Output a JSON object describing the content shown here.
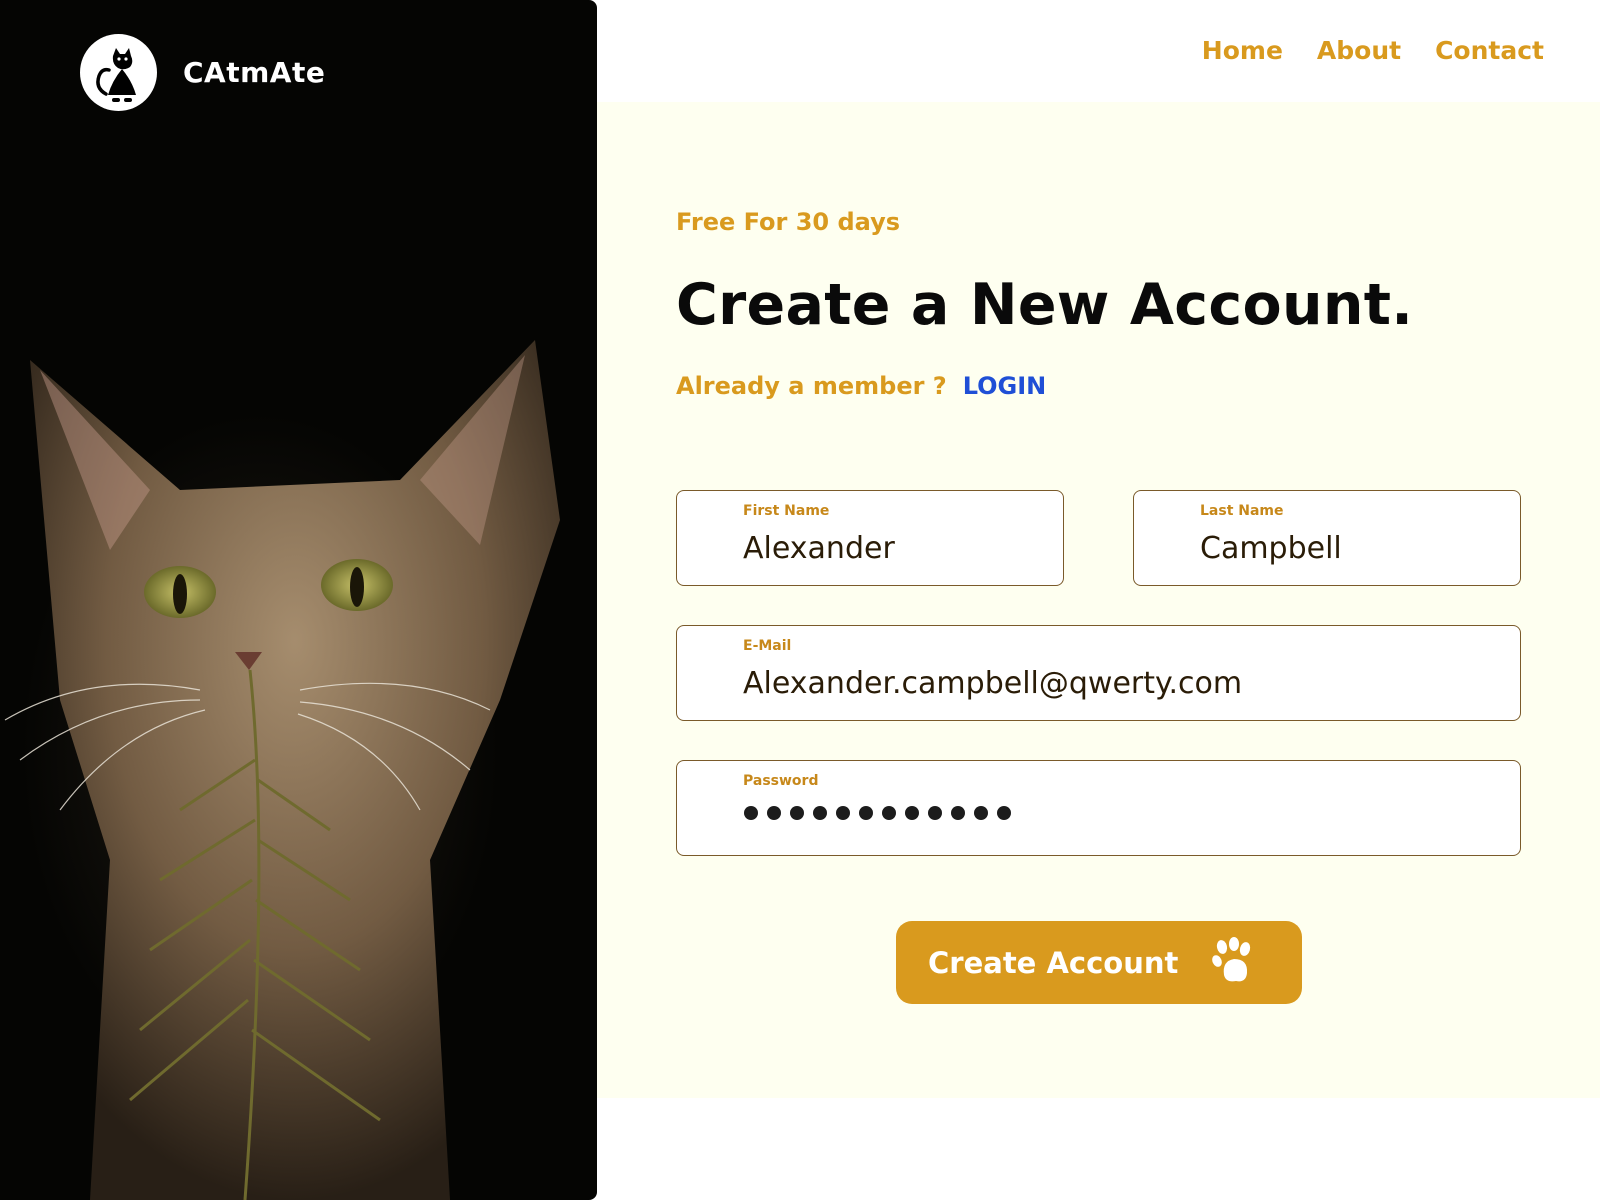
{
  "brand": {
    "name": "CAtmAte",
    "logo_icon": "cat-logo-icon"
  },
  "nav": {
    "items": [
      "Home",
      "About",
      "Contact"
    ]
  },
  "promo": "Free For 30 days",
  "heading": "Create a New Account.",
  "member": {
    "text": "Already a member ?",
    "login_label": "LOGIN"
  },
  "form": {
    "first_name": {
      "label": "First Name",
      "value": "Alexander"
    },
    "last_name": {
      "label": "Last Name",
      "value": "Campbell"
    },
    "email": {
      "label": "E-Mail",
      "value": "Alexander.campbell@qwerty.com"
    },
    "password": {
      "label": "Password",
      "masked_length": 12
    }
  },
  "cta": {
    "label": "Create Account",
    "icon": "paw-icon"
  },
  "colors": {
    "accent": "#d99a1e",
    "panel": "#fefff0",
    "link": "#1f4fd6",
    "dark": "#050503"
  }
}
